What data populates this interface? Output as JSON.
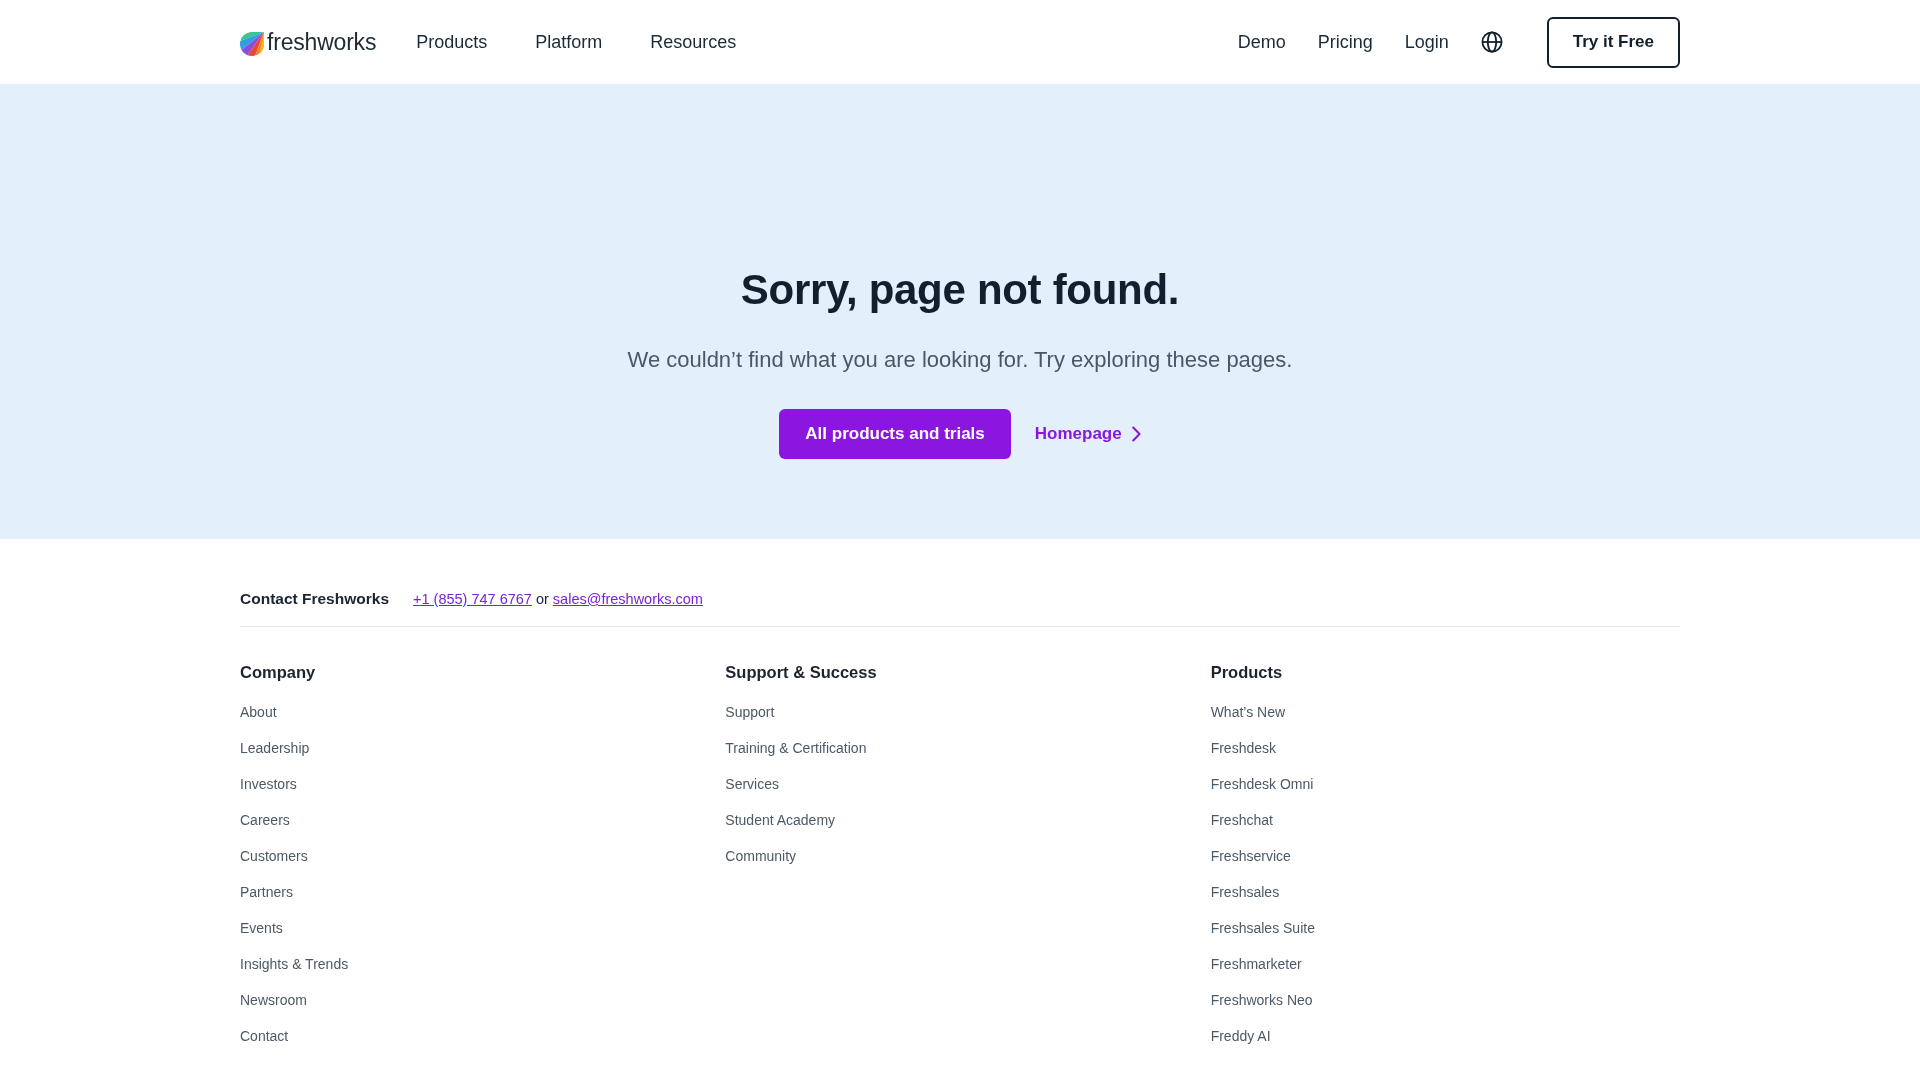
{
  "header": {
    "logo": "freshworks",
    "nav": [
      "Products",
      "Platform",
      "Resources"
    ],
    "utility_links": [
      "Demo",
      "Pricing",
      "Login"
    ],
    "cta_button": "Try it Free"
  },
  "hero": {
    "title": "Sorry, page not found.",
    "subtitle": "We couldn’t find what you are looking for. Try exploring these pages.",
    "primary_button": "All products and trials",
    "secondary_link": "Homepage"
  },
  "contact": {
    "label": "Contact Freshworks",
    "phone": "+1 (855) 747 6767",
    "separator": "or",
    "email": "sales@freshworks.com"
  },
  "footer_columns": [
    {
      "heading": "Company",
      "links": [
        "About",
        "Leadership",
        "Investors",
        "Careers",
        "Customers",
        "Partners",
        "Events",
        "Insights & Trends",
        "Newsroom",
        "Contact"
      ]
    },
    {
      "heading": "Support & Success",
      "links": [
        "Support",
        "Training & Certification",
        "Services",
        "Student Academy",
        "Community"
      ]
    },
    {
      "heading": "Products",
      "links": [
        "What’s New",
        "Freshdesk",
        "Freshdesk Omni",
        "Freshchat",
        "Freshservice",
        "Freshsales",
        "Freshsales Suite",
        "Freshmarketer",
        "Freshworks Neo",
        "Freddy AI"
      ]
    }
  ]
}
